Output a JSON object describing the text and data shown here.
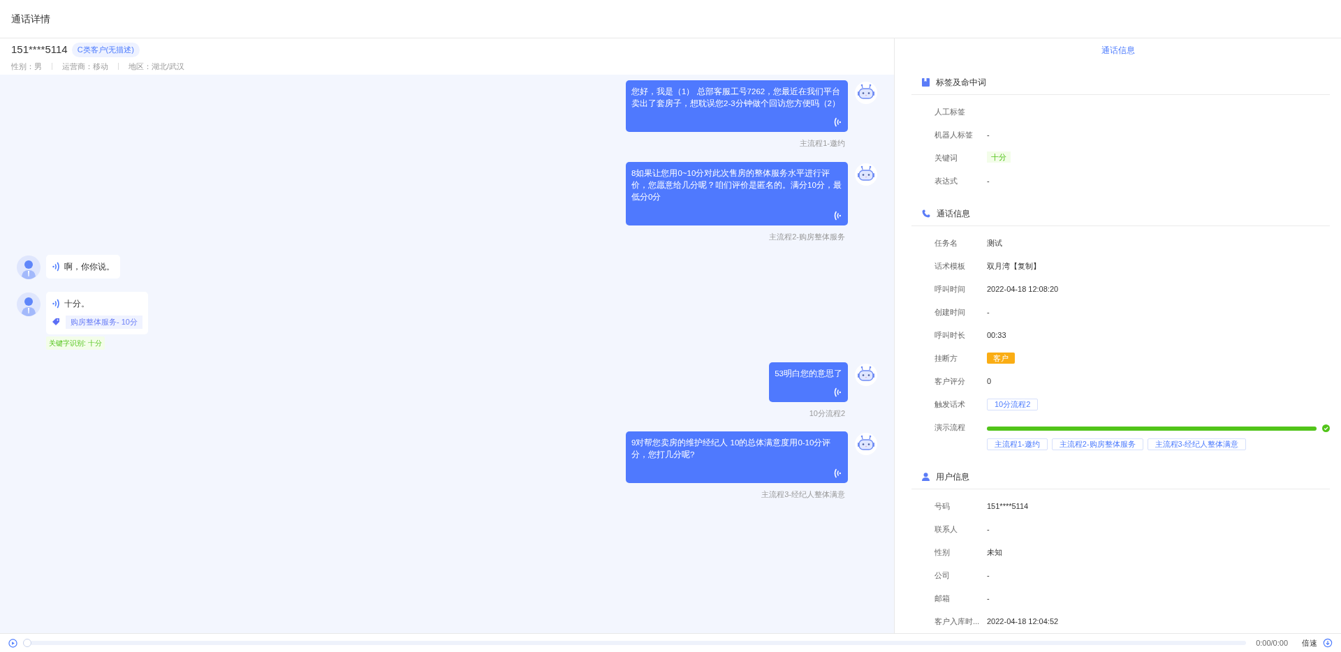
{
  "page": {
    "title": "通话详情"
  },
  "customer": {
    "phone": "151****5114",
    "tag": "C类客户(无描述)",
    "info": [
      "性别：男",
      "运营商：移动",
      "地区：湖北/武汉"
    ]
  },
  "messages": [
    {
      "kind": "bot",
      "text": "您好，我是（1） 总部客服工号7262，您最近在我们平台卖出了套房子，想耽误您2-3分钟做个回访您方便吗（2）",
      "flow": "主流程1-邀约"
    },
    {
      "kind": "bot",
      "text": "8如果让您用0~10分对此次售房的整体服务水平进行评价，您愿意给几分呢？咱们评价是匿名的。满分10分，最低分0分",
      "flow": "主流程2-购房整体服务"
    },
    {
      "kind": "user",
      "text": "啊，你你说。"
    },
    {
      "kind": "user",
      "text": "十分。",
      "tag": "购房整体服务- 10分",
      "keyword": "关键字识别: 十分"
    },
    {
      "kind": "bot",
      "text": "53明白您的意思了",
      "flow": "10分流程2"
    },
    {
      "kind": "bot",
      "text": "9对帮您卖房的维护经纪人 10的总体满意度用0-10分评分，您打几分呢?",
      "flow": "主流程3-经纪人整体满意"
    }
  ],
  "panel": {
    "tab": "通话信息",
    "sections": [
      {
        "kind": "tags",
        "title": "标签及命中词",
        "rows": [
          {
            "kind": "text",
            "label": "人工标签"
          },
          {
            "kind": "text",
            "label": "机器人标签",
            "value": "-"
          },
          {
            "kind": "green_tag",
            "label": "关键词",
            "value": "十分"
          },
          {
            "kind": "text",
            "label": "表达式",
            "value": "-"
          }
        ]
      },
      {
        "kind": "call",
        "title": "通话信息",
        "rows": [
          {
            "kind": "text",
            "label": "任务名",
            "value": "测试"
          },
          {
            "kind": "text",
            "label": "话术模板",
            "value": "双月湾【复制】"
          },
          {
            "kind": "text",
            "label": "呼叫时间",
            "value": "2022-04-18 12:08:20"
          },
          {
            "kind": "text",
            "label": "创建时间",
            "value": "-"
          },
          {
            "kind": "text",
            "label": "呼叫时长",
            "value": "00:33"
          },
          {
            "kind": "orange_tag",
            "label": "挂断方",
            "value": "客户"
          },
          {
            "kind": "text",
            "label": "客户评分",
            "value": "0"
          },
          {
            "kind": "blue_tag",
            "label": "触发话术",
            "value": "10分流程2"
          },
          {
            "kind": "progress",
            "label": "演示流程",
            "level": 1,
            "complete": true,
            "steps": [
              "主流程1-邀约",
              "主流程2-购房整体服务",
              "主流程3-经纪人整体满意"
            ]
          }
        ]
      },
      {
        "kind": "user",
        "title": "用户信息",
        "rows": [
          {
            "kind": "text",
            "label": "号码",
            "value": "151****5114"
          },
          {
            "kind": "text",
            "label": "联系人",
            "value": "-"
          },
          {
            "kind": "text",
            "label": "性别",
            "value": "未知"
          },
          {
            "kind": "text",
            "label": "公司",
            "value": "-"
          },
          {
            "kind": "text",
            "label": "邮箱",
            "value": "-"
          },
          {
            "kind": "text",
            "label": "客户入库时...",
            "value": "2022-04-18 12:04:52"
          }
        ]
      }
    ]
  },
  "player": {
    "level": 0,
    "time": "0:00/0:00",
    "speed": "倍速"
  }
}
